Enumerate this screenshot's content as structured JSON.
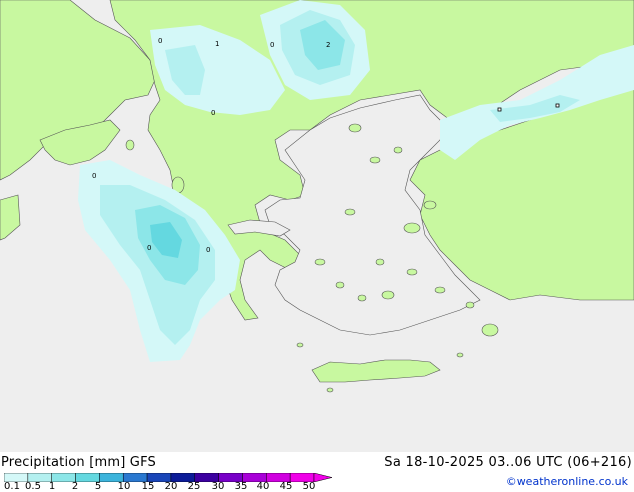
{
  "title": {
    "left": "Precipitation [mm] GFS",
    "right": "Sa 18-10-2025 03..06 UTC (06+216)"
  },
  "credit": "©weatheronline.co.uk",
  "legend": {
    "labels": [
      "0.1",
      "0.5",
      "1",
      "2",
      "5",
      "10",
      "15",
      "20",
      "25",
      "30",
      "35",
      "40",
      "45",
      "50"
    ],
    "colors": [
      "#d4f8f8",
      "#b4f0f0",
      "#8ce6e8",
      "#64d8e0",
      "#3cb4dc",
      "#2a78d0",
      "#1a46b8",
      "#0c1c98",
      "#3c00a0",
      "#7800c8",
      "#a800d8",
      "#d000e0",
      "#f000e8"
    ]
  },
  "map": {
    "colors": {
      "sea": "#eeeeee",
      "land": "#c8f8a0",
      "coast": "#555555"
    },
    "point_labels": [
      "0",
      "1",
      "0",
      "2",
      "0",
      "0",
      "0",
      "0"
    ]
  }
}
